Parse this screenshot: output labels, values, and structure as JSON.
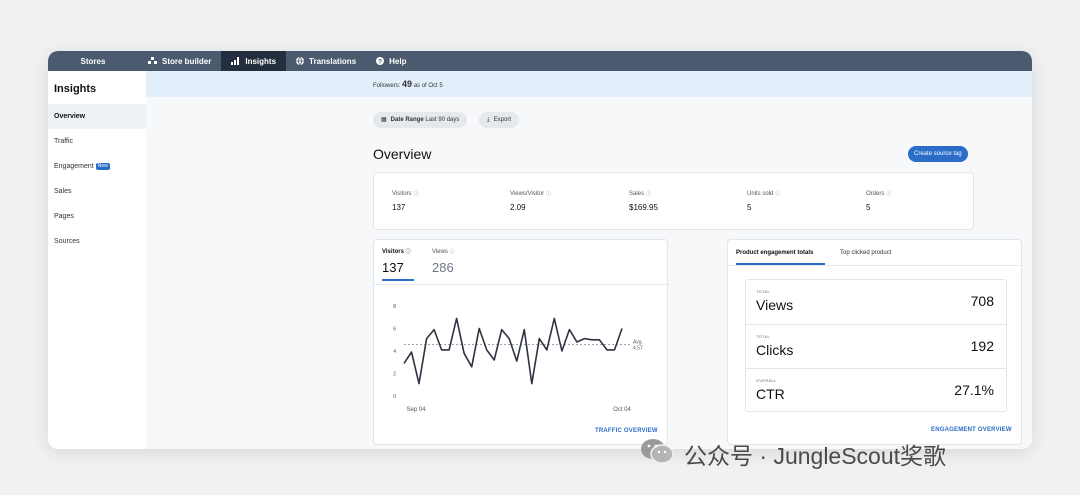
{
  "topbar": {
    "tabs": [
      {
        "label": "Stores",
        "icon": "none",
        "active": false
      },
      {
        "label": "Store builder",
        "icon": "store-builder-icon",
        "active": false
      },
      {
        "label": "Insights",
        "icon": "bar-chart-icon",
        "active": true
      },
      {
        "label": "Translations",
        "icon": "globe-icon",
        "active": false
      },
      {
        "label": "Help",
        "icon": "help-circle-icon",
        "active": false
      }
    ]
  },
  "sidebar": {
    "title": "Insights",
    "items": [
      {
        "label": "Overview",
        "active": true
      },
      {
        "label": "Traffic"
      },
      {
        "label": "Engagement",
        "badge": "New"
      },
      {
        "label": "Sales"
      },
      {
        "label": "Pages"
      },
      {
        "label": "Sources"
      }
    ]
  },
  "followers": {
    "prefix": "Followers:",
    "count": "49",
    "suffix": "as of Oct 5"
  },
  "filters": {
    "date_label": "Date Range",
    "date_value": "Last 90 days",
    "export_label": "Export"
  },
  "overview": {
    "title": "Overview",
    "create_button": "Create source tag",
    "metrics": [
      {
        "label": "Visitors",
        "value": "137"
      },
      {
        "label": "Views/Visitor",
        "value": "2.09"
      },
      {
        "label": "Sales",
        "value": "$169.95"
      },
      {
        "label": "Units sold",
        "value": "5"
      },
      {
        "label": "Orders",
        "value": "5"
      }
    ]
  },
  "traffic_card": {
    "tabs": [
      {
        "label": "Visitors",
        "value": "137",
        "active": true
      },
      {
        "label": "Views",
        "value": "286",
        "active": false
      }
    ],
    "link": "TRAFFIC OVERVIEW"
  },
  "chart_data": {
    "type": "line",
    "series": [
      {
        "values": [
          2.9,
          3.9,
          1.1,
          5.1,
          5.9,
          4.1,
          4.1,
          6.9,
          3.8,
          2.6,
          6.0,
          4.1,
          3.2,
          5.9,
          5.1,
          3.1,
          5.9,
          1.1,
          5.1,
          4.1,
          6.9,
          4.0,
          5.9,
          4.8,
          5.1,
          5.0,
          5.0,
          4.1,
          4.1,
          6.0
        ]
      }
    ],
    "x_tick_labels": [
      "Sep 04",
      "Oct 04"
    ],
    "y_ticks": [
      0,
      2,
      4,
      6,
      8
    ],
    "ylim": [
      0,
      8
    ],
    "reference_line": {
      "label": "Avg.",
      "value": "4.57",
      "y": 4.57
    },
    "grid": false
  },
  "engagement_card": {
    "tabs": [
      {
        "label": "Product engagement totals",
        "active": true
      },
      {
        "label": "Top clicked product",
        "active": false
      }
    ],
    "rows": [
      {
        "caption": "TOTAL",
        "name": "Views",
        "value": "708"
      },
      {
        "caption": "TOTAL",
        "name": "Clicks",
        "value": "192"
      },
      {
        "caption": "OVERALL",
        "name": "CTR",
        "value": "27.1%"
      }
    ],
    "link": "ENGAGEMENT OVERVIEW"
  },
  "watermark": {
    "text": "公众号 · JungleScout奖歌"
  }
}
